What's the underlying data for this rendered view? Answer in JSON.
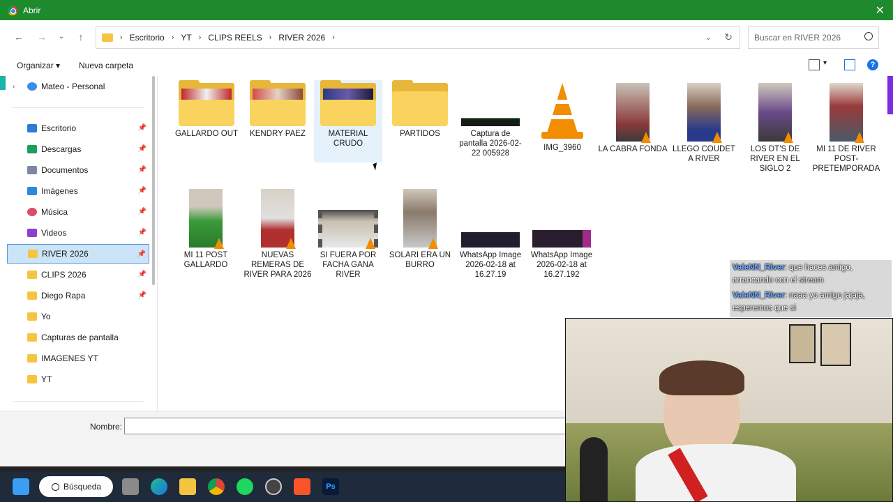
{
  "window": {
    "title": "Abrir",
    "close_label": "✕"
  },
  "breadcrumb": [
    "Escritorio",
    "YT",
    "CLIPS REELS",
    "RIVER 2026"
  ],
  "search": {
    "placeholder": "Buscar en RIVER 2026"
  },
  "toolbar": {
    "organize": "Organizar",
    "new_folder": "Nueva carpeta"
  },
  "sidebar": {
    "account": "Mateo - Personal",
    "items": [
      "Escritorio",
      "Descargas",
      "Documentos",
      "Imágenes",
      "Música",
      "Videos",
      "RIVER 2026",
      "CLIPS 2026",
      "Diego Rapa",
      "Yo",
      "Capturas de pantalla",
      "IMAGENES YT",
      "YT"
    ],
    "selected": "RIVER 2026"
  },
  "files": [
    {
      "name": "GALLARDO OUT",
      "type": "folder"
    },
    {
      "name": "KENDRY PAEZ",
      "type": "folder"
    },
    {
      "name": "MATERIAL CRUDO",
      "type": "folder"
    },
    {
      "name": "PARTIDOS",
      "type": "folder"
    },
    {
      "name": "Captura de pantalla 2026-02-22 005928",
      "type": "image"
    },
    {
      "name": "IMG_3960",
      "type": "vlc"
    },
    {
      "name": "LA CABRA FONDA",
      "type": "video"
    },
    {
      "name": "LLEGO COUDET A RIVER",
      "type": "video"
    },
    {
      "name": "LOS DT'S DE RIVER EN EL SIGLO 2",
      "type": "video"
    },
    {
      "name": "MI 11 DE RIVER POST-PRETEMPORADA",
      "type": "video"
    },
    {
      "name": "MI 11 POST GALLARDO",
      "type": "video"
    },
    {
      "name": "NUEVAS REMERAS DE RIVER PARA 2026",
      "type": "video"
    },
    {
      "name": "SI FUERA POR FACHA GANA RIVER",
      "type": "video"
    },
    {
      "name": "SOLARI ERA UN BURRO",
      "type": "video"
    },
    {
      "name": "WhatsApp Image 2026-02-18 at 16.27.19",
      "type": "image"
    },
    {
      "name": "WhatsApp Image 2026-02-18 at 16.27.192",
      "type": "image"
    }
  ],
  "filename": {
    "label": "Nombre:",
    "value": ""
  },
  "taskbar": {
    "search_label": "Búsqueda"
  },
  "chat": [
    {
      "user": "ValeNN_River",
      "text": ": que haces amigo, arrancando con el stream"
    },
    {
      "user": "ValeNN_River",
      "text": ": naaa yo amigo jajaja, esperemos que si"
    }
  ],
  "colors": {
    "title_bar": "#1e8a2e",
    "selected": "#cce4f7",
    "folder": "#f9d35e"
  }
}
